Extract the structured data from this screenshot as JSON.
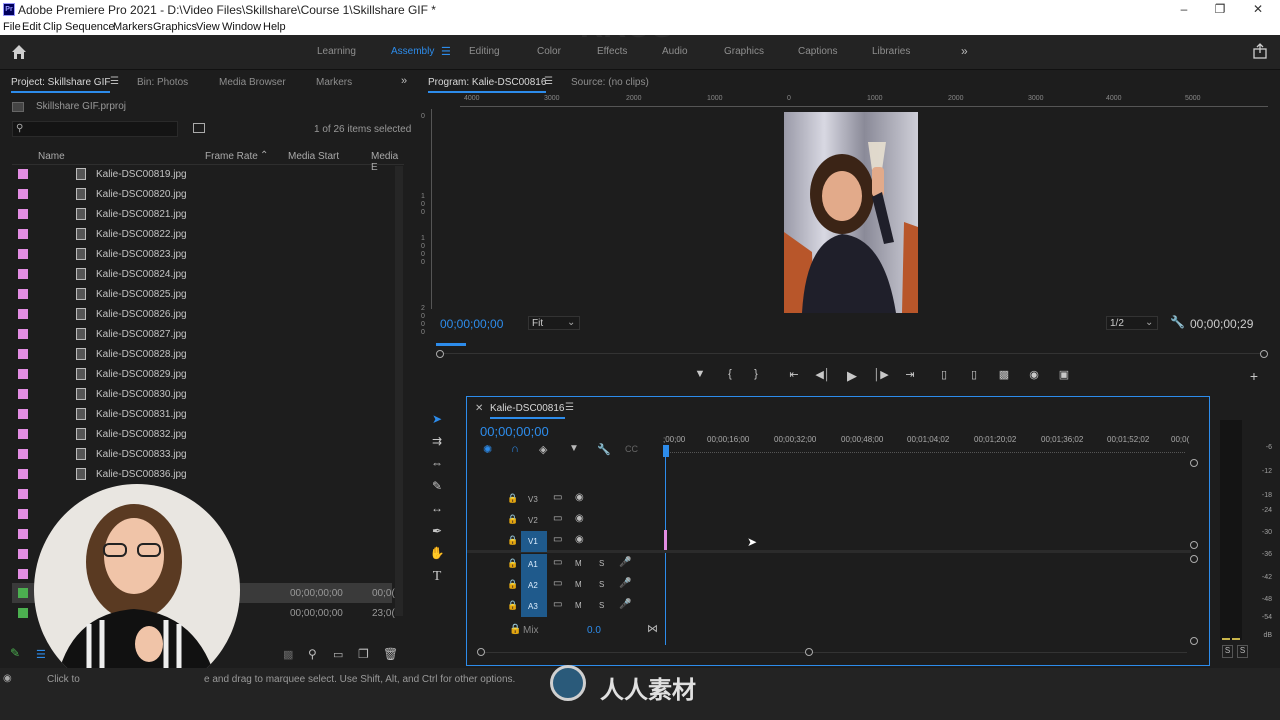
{
  "titlebar": {
    "logo": "Pr",
    "title": "Adobe Premiere Pro 2021 - D:\\Video Files\\Skillshare\\Course 1\\Skillshare GIF *"
  },
  "menu": [
    "File",
    "Edit",
    "Clip",
    "Sequence",
    "Markers",
    "Graphics",
    "View",
    "Window",
    "Help"
  ],
  "workspaces": [
    "Learning",
    "Assembly",
    "Editing",
    "Color",
    "Effects",
    "Audio",
    "Graphics",
    "Captions",
    "Libraries"
  ],
  "active_workspace": "Assembly",
  "project": {
    "tabs": [
      "Project: Skillshare GIF",
      "Bin: Photos",
      "Media Browser",
      "Markers"
    ],
    "file": "Skillshare GIF.prproj",
    "selected": "1 of 26 items selected",
    "columns": [
      "Name",
      "Frame Rate",
      "Media Start",
      "Media E"
    ],
    "items": [
      "Kalie-DSC00819.jpg",
      "Kalie-DSC00820.jpg",
      "Kalie-DSC00821.jpg",
      "Kalie-DSC00822.jpg",
      "Kalie-DSC00823.jpg",
      "Kalie-DSC00824.jpg",
      "Kalie-DSC00825.jpg",
      "Kalie-DSC00826.jpg",
      "Kalie-DSC00827.jpg",
      "Kalie-DSC00828.jpg",
      "Kalie-DSC00829.jpg",
      "Kalie-DSC00830.jpg",
      "Kalie-DSC00831.jpg",
      "Kalie-DSC00832.jpg",
      "Kalie-DSC00833.jpg",
      "Kalie-DSC00836.jpg"
    ],
    "seq_row1": {
      "start": "00;00;00;00",
      "end": "00;0("
    },
    "seq_row2": {
      "start": "00;00;00;00",
      "end": "23;0("
    }
  },
  "program": {
    "tab": "Program: Kalie-DSC00816",
    "source_tab": "Source: (no clips)",
    "ruler_labels": [
      "4000",
      "3000",
      "2000",
      "1000",
      "0",
      "1000",
      "2000",
      "3000",
      "4000",
      "5000"
    ],
    "vruler_labels": [
      "0",
      "1",
      "0",
      "0",
      "1",
      "0",
      "0",
      "0",
      "2",
      "0",
      "0",
      "0"
    ],
    "timecode": "00;00;00;00",
    "fit": "Fit",
    "resolution": "1/2",
    "duration": "00;00;00;29"
  },
  "timeline": {
    "tab": "Kalie-DSC00816",
    "timecode": "00;00;00;00",
    "ruler": [
      ";00;00",
      "00;00;16;00",
      "00;00;32;00",
      "00;00;48;00",
      "00;01;04;02",
      "00;01;20;02",
      "00;01;36;02",
      "00;01;52;02",
      "00;0("
    ],
    "video_tracks": [
      "V3",
      "V2",
      "V1"
    ],
    "audio_tracks": [
      "A1",
      "A2",
      "A3"
    ],
    "mix_label": "Mix",
    "mix_value": "0.0",
    "m": "M",
    "s": "S"
  },
  "meter": {
    "ticks": [
      "-6",
      "-12",
      "-18",
      "-24",
      "-30",
      "-36",
      "-42",
      "-48",
      "-54",
      "dB"
    ],
    "solo": [
      "S",
      "S"
    ]
  },
  "status": {
    "left": "Click to",
    "right": "e and drag to marquee select. Use Shift, Alt, and Ctrl for other options."
  },
  "watermark": {
    "brand": "RRCG",
    "cn": "人人素材"
  },
  "colors": {
    "accent": "#2d8ceb",
    "label_pink": "#e38de3",
    "label_green": "#4caf50"
  }
}
